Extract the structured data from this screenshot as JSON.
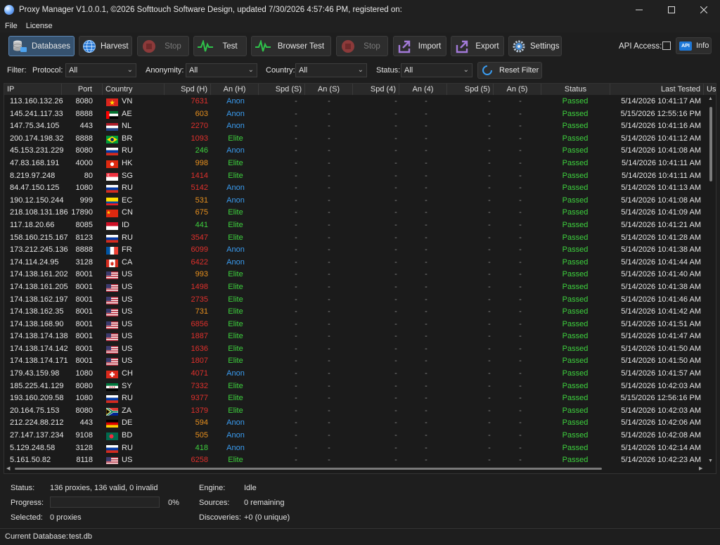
{
  "window": {
    "title": "Proxy Manager V1.0.0.1, ©2026 Softtouch Software Design, updated 7/30/2026 4:57:46 PM, registered on:",
    "minimize": "—",
    "maximize": "☐",
    "close": "✕"
  },
  "menu": [
    "File",
    "License"
  ],
  "toolbar": {
    "databases": "Databases",
    "harvest": "Harvest",
    "stop1": "Stop",
    "test": "Test",
    "browser_test": "Browser Test",
    "stop2": "Stop",
    "import": "Import",
    "export": "Export",
    "settings": "Settings",
    "api_access": "API Access:",
    "api_badge": "API",
    "info": "Info"
  },
  "filter": {
    "filter_label": "Filter:",
    "protocol_label": "Protocol:",
    "protocol_value": "All",
    "anonymity_label": "Anonymity:",
    "anonymity_value": "All",
    "country_label": "Country:",
    "country_value": "All",
    "status_label": "Status:",
    "status_value": "All",
    "reset": "Reset Filter"
  },
  "columns": [
    "IP",
    "Port",
    "Country",
    "Spd (H)",
    "An (H)",
    "Spd (S)",
    "An (S)",
    "Spd (4)",
    "An (4)",
    "Spd (5)",
    "An (5)",
    "Status",
    "Last Tested",
    "Use"
  ],
  "colors": {
    "speed_green": "#3ed23e",
    "speed_orange": "#e8901e",
    "speed_red": "#e0302c",
    "anon_blue": "#3a9cf0",
    "elite_green": "#3ed23e",
    "passed_green": "#3ed23e"
  },
  "rows": [
    {
      "ip": "113.160.132.26",
      "port": "8080",
      "cc": "VN",
      "spd": "7631",
      "an": "Anon",
      "st": "Passed",
      "lt": "5/14/2026 10:41:17 AM"
    },
    {
      "ip": "145.241.117.33",
      "port": "8888",
      "cc": "AE",
      "spd": "603",
      "an": "Anon",
      "st": "Passed",
      "lt": "5/15/2026 12:55:16 PM"
    },
    {
      "ip": "147.75.34.105",
      "port": "443",
      "cc": "NL",
      "spd": "2270",
      "an": "Anon",
      "st": "Passed",
      "lt": "5/14/2026 10:41:16 AM"
    },
    {
      "ip": "200.174.198.32",
      "port": "8888",
      "cc": "BR",
      "spd": "1093",
      "an": "Elite",
      "st": "Passed",
      "lt": "5/14/2026 10:41:12 AM"
    },
    {
      "ip": "45.153.231.229",
      "port": "8080",
      "cc": "RU",
      "spd": "246",
      "an": "Anon",
      "st": "Passed",
      "lt": "5/14/2026 10:41:08 AM"
    },
    {
      "ip": "47.83.168.191",
      "port": "4000",
      "cc": "HK",
      "spd": "998",
      "an": "Elite",
      "st": "Passed",
      "lt": "5/14/2026 10:41:11 AM"
    },
    {
      "ip": "8.219.97.248",
      "port": "80",
      "cc": "SG",
      "spd": "1414",
      "an": "Elite",
      "st": "Passed",
      "lt": "5/14/2026 10:41:11 AM"
    },
    {
      "ip": "84.47.150.125",
      "port": "1080",
      "cc": "RU",
      "spd": "5142",
      "an": "Anon",
      "st": "Passed",
      "lt": "5/14/2026 10:41:13 AM"
    },
    {
      "ip": "190.12.150.244",
      "port": "999",
      "cc": "EC",
      "spd": "531",
      "an": "Anon",
      "st": "Passed",
      "lt": "5/14/2026 10:41:08 AM"
    },
    {
      "ip": "218.108.131.186",
      "port": "17890",
      "cc": "CN",
      "spd": "675",
      "an": "Elite",
      "st": "Passed",
      "lt": "5/14/2026 10:41:09 AM"
    },
    {
      "ip": "117.18.20.66",
      "port": "8085",
      "cc": "ID",
      "spd": "441",
      "an": "Elite",
      "st": "Passed",
      "lt": "5/14/2026 10:41:21 AM"
    },
    {
      "ip": "158.160.215.167",
      "port": "8123",
      "cc": "RU",
      "spd": "3547",
      "an": "Elite",
      "st": "Passed",
      "lt": "5/14/2026 10:41:28 AM"
    },
    {
      "ip": "173.212.245.136",
      "port": "8888",
      "cc": "FR",
      "spd": "6099",
      "an": "Anon",
      "st": "Passed",
      "lt": "5/14/2026 10:41:38 AM"
    },
    {
      "ip": "174.114.24.95",
      "port": "3128",
      "cc": "CA",
      "spd": "6422",
      "an": "Anon",
      "st": "Passed",
      "lt": "5/14/2026 10:41:44 AM"
    },
    {
      "ip": "174.138.161.202",
      "port": "8001",
      "cc": "US",
      "spd": "993",
      "an": "Elite",
      "st": "Passed",
      "lt": "5/14/2026 10:41:40 AM"
    },
    {
      "ip": "174.138.161.205",
      "port": "8001",
      "cc": "US",
      "spd": "1498",
      "an": "Elite",
      "st": "Passed",
      "lt": "5/14/2026 10:41:38 AM"
    },
    {
      "ip": "174.138.162.197",
      "port": "8001",
      "cc": "US",
      "spd": "2735",
      "an": "Elite",
      "st": "Passed",
      "lt": "5/14/2026 10:41:46 AM"
    },
    {
      "ip": "174.138.162.35",
      "port": "8001",
      "cc": "US",
      "spd": "731",
      "an": "Elite",
      "st": "Passed",
      "lt": "5/14/2026 10:41:42 AM"
    },
    {
      "ip": "174.138.168.90",
      "port": "8001",
      "cc": "US",
      "spd": "6856",
      "an": "Elite",
      "st": "Passed",
      "lt": "5/14/2026 10:41:51 AM"
    },
    {
      "ip": "174.138.174.138",
      "port": "8001",
      "cc": "US",
      "spd": "1887",
      "an": "Elite",
      "st": "Passed",
      "lt": "5/14/2026 10:41:47 AM"
    },
    {
      "ip": "174.138.174.142",
      "port": "8001",
      "cc": "US",
      "spd": "1636",
      "an": "Elite",
      "st": "Passed",
      "lt": "5/14/2026 10:41:50 AM"
    },
    {
      "ip": "174.138.174.171",
      "port": "8001",
      "cc": "US",
      "spd": "1807",
      "an": "Elite",
      "st": "Passed",
      "lt": "5/14/2026 10:41:50 AM"
    },
    {
      "ip": "179.43.159.98",
      "port": "1080",
      "cc": "CH",
      "spd": "4071",
      "an": "Anon",
      "st": "Passed",
      "lt": "5/14/2026 10:41:57 AM"
    },
    {
      "ip": "185.225.41.129",
      "port": "8080",
      "cc": "SY",
      "spd": "7332",
      "an": "Elite",
      "st": "Passed",
      "lt": "5/14/2026 10:42:03 AM"
    },
    {
      "ip": "193.160.209.58",
      "port": "1080",
      "cc": "RU",
      "spd": "9377",
      "an": "Elite",
      "st": "Passed",
      "lt": "5/15/2026 12:56:16 PM"
    },
    {
      "ip": "20.164.75.153",
      "port": "8080",
      "cc": "ZA",
      "spd": "1379",
      "an": "Elite",
      "st": "Passed",
      "lt": "5/14/2026 10:42:03 AM"
    },
    {
      "ip": "212.224.88.212",
      "port": "443",
      "cc": "DE",
      "spd": "594",
      "an": "Anon",
      "st": "Passed",
      "lt": "5/14/2026 10:42:06 AM"
    },
    {
      "ip": "27.147.137.234",
      "port": "9108",
      "cc": "BD",
      "spd": "505",
      "an": "Anon",
      "st": "Passed",
      "lt": "5/14/2026 10:42:08 AM"
    },
    {
      "ip": "5.129.248.58",
      "port": "3128",
      "cc": "RU",
      "spd": "418",
      "an": "Anon",
      "st": "Passed",
      "lt": "5/14/2026 10:42:14 AM"
    },
    {
      "ip": "5.161.50.82",
      "port": "8118",
      "cc": "US",
      "spd": "6258",
      "an": "Elite",
      "st": "Passed",
      "lt": "5/14/2026 10:42:23 AM"
    }
  ],
  "dash": "-",
  "status": {
    "status_label": "Status:",
    "status_value": "136 proxies, 136 valid, 0 invalid",
    "progress_label": "Progress:",
    "progress_percent": "0%",
    "progress_fraction": 0,
    "selected_label": "Selected:",
    "selected_value": "0 proxies",
    "engine_label": "Engine:",
    "engine_value": "Idle",
    "sources_label": "Sources:",
    "sources_value": "0 remaining",
    "discoveries_label": "Discoveries:",
    "discoveries_value": "+0 (0 unique)",
    "db_label": "Current Database:",
    "db_value": "test.db"
  }
}
